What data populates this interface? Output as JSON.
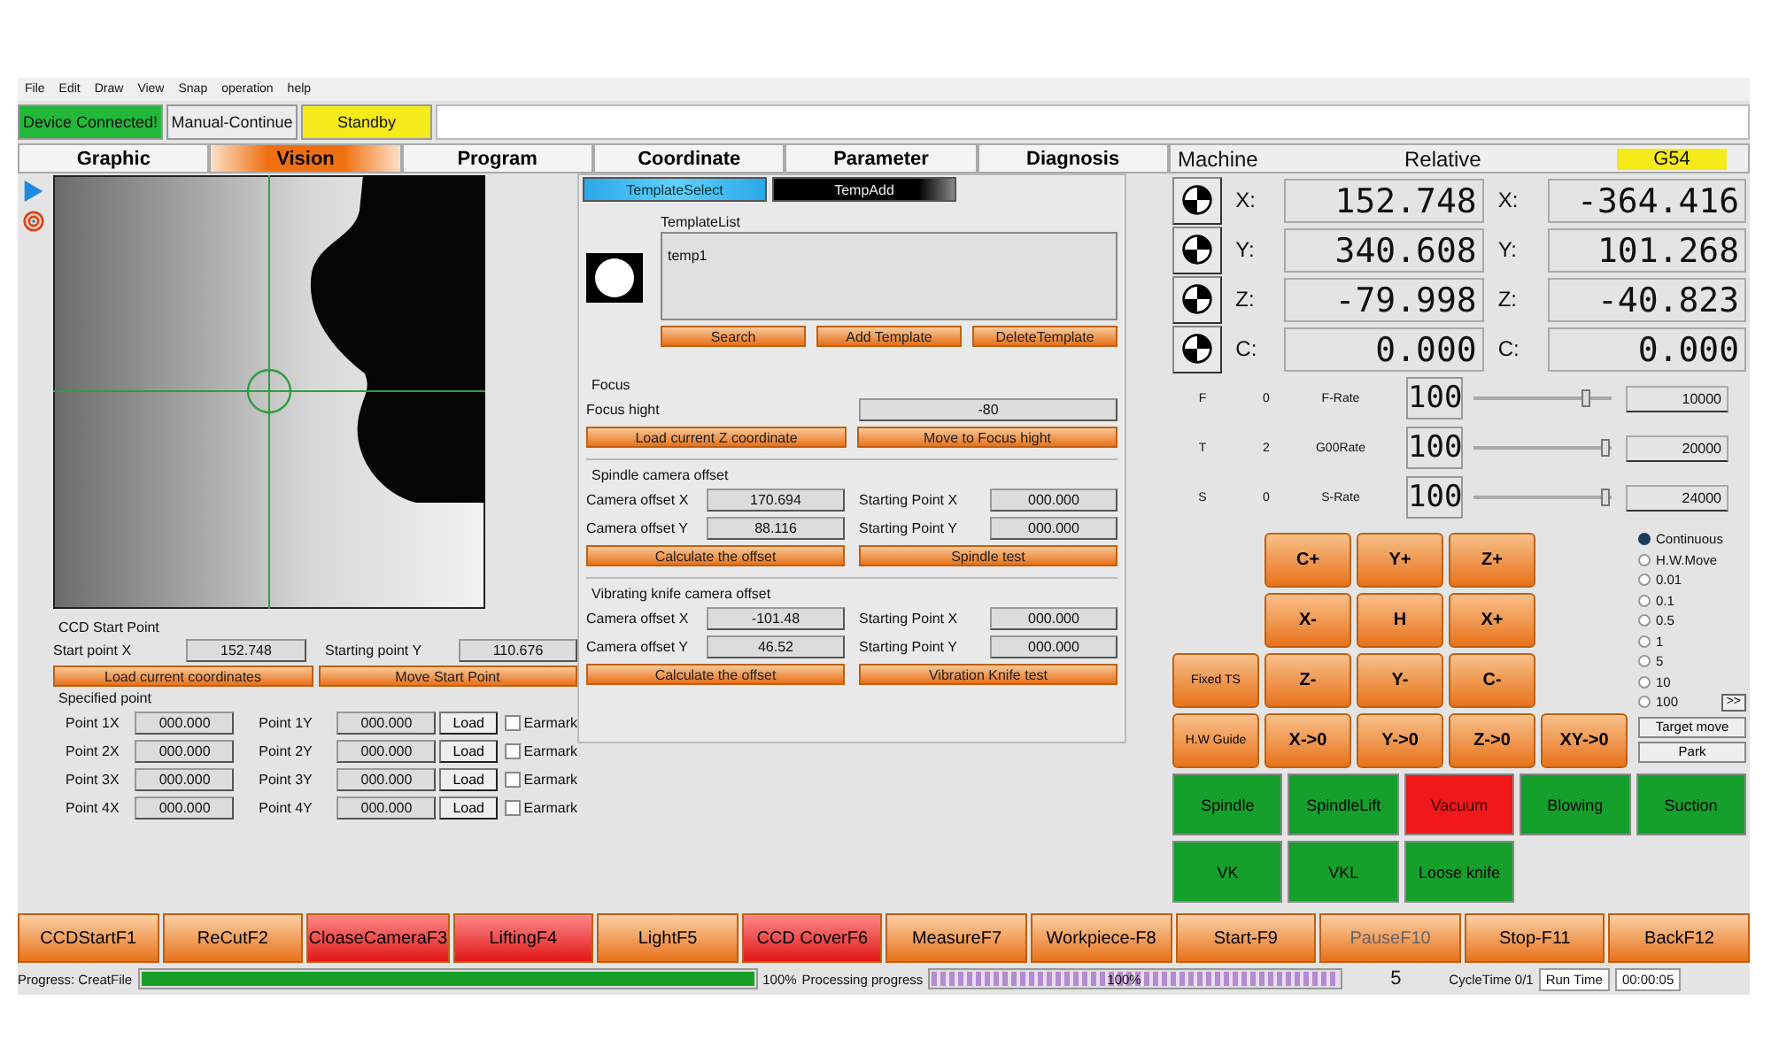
{
  "menu": [
    "File",
    "Edit",
    "Draw",
    "View",
    "Snap",
    "operation",
    "help"
  ],
  "status": [
    {
      "label": "Device Connected!",
      "kind": "connected"
    },
    {
      "label": "Manual-Continue",
      "kind": "mode"
    },
    {
      "label": "Standby",
      "kind": "state"
    }
  ],
  "tabs": [
    {
      "label": "Graphic",
      "selected": false
    },
    {
      "label": "Vision",
      "selected": true
    },
    {
      "label": "Program",
      "selected": false
    },
    {
      "label": "Coordinate",
      "selected": false
    },
    {
      "label": "Parameter",
      "selected": false
    },
    {
      "label": "Diagnosis",
      "selected": false
    }
  ],
  "coords": {
    "machine_label": "Machine",
    "relative_label": "Relative",
    "system": "G54",
    "axes": [
      {
        "axis": "X:",
        "machine": "152.748",
        "relative_axis": "X:",
        "relative": "-364.416"
      },
      {
        "axis": "Y:",
        "machine": "340.608",
        "relative_axis": "Y:",
        "relative": "101.268"
      },
      {
        "axis": "Z:",
        "machine": "-79.998",
        "relative_axis": "Z:",
        "relative": "-40.823"
      },
      {
        "axis": "C:",
        "machine": "0.000",
        "relative_axis": "C:",
        "relative": "0.000"
      }
    ]
  },
  "rates": [
    {
      "letter": "F",
      "value": "0",
      "name": "F-Rate",
      "percent": "100",
      "level": 0.84,
      "max": "10000"
    },
    {
      "letter": "T",
      "value": "2",
      "name": "G00Rate",
      "percent": "100",
      "level": 0.98,
      "max": "20000"
    },
    {
      "letter": "S",
      "value": "0",
      "name": "S-Rate",
      "percent": "100",
      "level": 0.98,
      "max": "24000"
    }
  ],
  "vision": {
    "template_tabs": [
      {
        "label": "TemplateSelect",
        "selected": true
      },
      {
        "label": "TempAdd",
        "selected": false
      }
    ],
    "template_list_label": "TemplateList",
    "templates": [
      "temp1"
    ],
    "template_buttons": [
      "Search",
      "Add Template",
      "DeleteTemplate"
    ],
    "focus": {
      "title": "Focus",
      "label": "Focus hight",
      "value": "-80",
      "buttons": [
        "Load current Z coordinate",
        "Move to Focus hight"
      ]
    },
    "offsets": [
      {
        "title": "Spindle camera offset",
        "rows": [
          {
            "label": "Camera offset X",
            "value": "170.694",
            "label2": "Starting Point X",
            "value2": "000.000"
          },
          {
            "label": "Camera offset Y",
            "value": "88.116",
            "label2": "Starting Point Y",
            "value2": "000.000"
          }
        ],
        "buttons": [
          "Calculate the offset",
          "Spindle test"
        ]
      },
      {
        "title": "Vibrating knife camera offset",
        "rows": [
          {
            "label": "Camera offset X",
            "value": "-101.48",
            "label2": "Starting Point X",
            "value2": "000.000"
          },
          {
            "label": "Camera offset Y",
            "value": "46.52",
            "label2": "Starting Point Y",
            "value2": "000.000"
          }
        ],
        "buttons": [
          "Calculate the offset",
          "Vibration Knife test"
        ]
      }
    ]
  },
  "ccd": {
    "title": "CCD Start Point",
    "x_label": "Start point X",
    "x_value": "152.748",
    "y_label": "Starting point Y",
    "y_value": "110.676",
    "buttons": [
      "Load current coordinates",
      "Move Start Point"
    ],
    "specified_title": "Specified point",
    "points": [
      {
        "x_label": "Point 1X",
        "x_value": "000.000",
        "y_label": "Point 1Y",
        "y_value": "000.000",
        "load": "Load",
        "earmark": "Earmark",
        "checked": false
      },
      {
        "x_label": "Point 2X",
        "x_value": "000.000",
        "y_label": "Point 2Y",
        "y_value": "000.000",
        "load": "Load",
        "earmark": "Earmark",
        "checked": false
      },
      {
        "x_label": "Point 3X",
        "x_value": "000.000",
        "y_label": "Point 3Y",
        "y_value": "000.000",
        "load": "Load",
        "earmark": "Earmark",
        "checked": false
      },
      {
        "x_label": "Point 4X",
        "x_value": "000.000",
        "y_label": "Point 4Y",
        "y_value": "000.000",
        "load": "Load",
        "earmark": "Earmark",
        "checked": false
      }
    ]
  },
  "jog": [
    [
      {
        "kind": "gap"
      },
      {
        "kind": "key",
        "label": "C+"
      },
      {
        "kind": "key",
        "label": "Y+"
      },
      {
        "kind": "key",
        "label": "Z+"
      },
      {
        "kind": "gap"
      }
    ],
    [
      {
        "kind": "gap"
      },
      {
        "kind": "key",
        "label": "X-"
      },
      {
        "kind": "key",
        "label": "H"
      },
      {
        "kind": "key",
        "label": "X+"
      },
      {
        "kind": "gap"
      }
    ],
    [
      {
        "kind": "small",
        "label": "Fixed TS"
      },
      {
        "kind": "key",
        "label": "Z-"
      },
      {
        "kind": "key",
        "label": "Y-"
      },
      {
        "kind": "key",
        "label": "C-"
      },
      {
        "kind": "gap"
      }
    ],
    [
      {
        "kind": "small",
        "label": "H.W Guide"
      },
      {
        "kind": "key",
        "label": "X->0"
      },
      {
        "kind": "key",
        "label": "Y->0"
      },
      {
        "kind": "key",
        "label": "Z->0"
      },
      {
        "kind": "key",
        "label": "XY->0"
      }
    ]
  ],
  "steps": [
    {
      "label": "Continuous",
      "selected": true
    },
    {
      "label": "H.W.Move",
      "selected": false
    },
    {
      "label": "0.01",
      "selected": false
    },
    {
      "label": "0.1",
      "selected": false
    },
    {
      "label": "0.5",
      "selected": false
    },
    {
      "label": "1",
      "selected": false
    },
    {
      "label": "5",
      "selected": false
    },
    {
      "label": "10",
      "selected": false
    },
    {
      "label": "100",
      "selected": false
    }
  ],
  "more": ">>",
  "target_move": "Target move",
  "park": "Park",
  "outputs": [
    {
      "label": "Spindle",
      "active": false
    },
    {
      "label": "SpindleLift",
      "active": false
    },
    {
      "label": "Vacuum",
      "active": true
    },
    {
      "label": "Blowing",
      "active": false
    },
    {
      "label": "Suction",
      "active": false
    },
    {
      "label": "VK",
      "active": false
    },
    {
      "label": "VKL",
      "active": false
    },
    {
      "label": "Loose knife",
      "active": false
    }
  ],
  "function_keys": [
    {
      "label": "CCDStartF1",
      "active": false,
      "disabled": false
    },
    {
      "label": "ReCutF2",
      "active": false,
      "disabled": false
    },
    {
      "label": "CloaseCameraF3",
      "active": true,
      "disabled": false
    },
    {
      "label": "LiftingF4",
      "active": true,
      "disabled": false
    },
    {
      "label": "LightF5",
      "active": false,
      "disabled": false
    },
    {
      "label": "CCD CoverF6",
      "active": true,
      "disabled": false
    },
    {
      "label": "MeasureF7",
      "active": false,
      "disabled": false
    },
    {
      "label": "Workpiece-F8",
      "active": false,
      "disabled": false
    },
    {
      "label": "Start-F9",
      "active": false,
      "disabled": false
    },
    {
      "label": "PauseF10",
      "active": false,
      "disabled": true
    },
    {
      "label": "Stop-F11",
      "active": false,
      "disabled": false
    },
    {
      "label": "BackF12",
      "active": false,
      "disabled": false
    }
  ],
  "progress": {
    "label": "Progress: CreatFile",
    "level": 1,
    "percent": "100%"
  },
  "processing": {
    "label": "Processing progress",
    "level": 1,
    "percent": "100%"
  },
  "count": "5",
  "cycle": "CycleTime 0/1",
  "run_label": "Run Time",
  "run_time": "00:00:05"
}
